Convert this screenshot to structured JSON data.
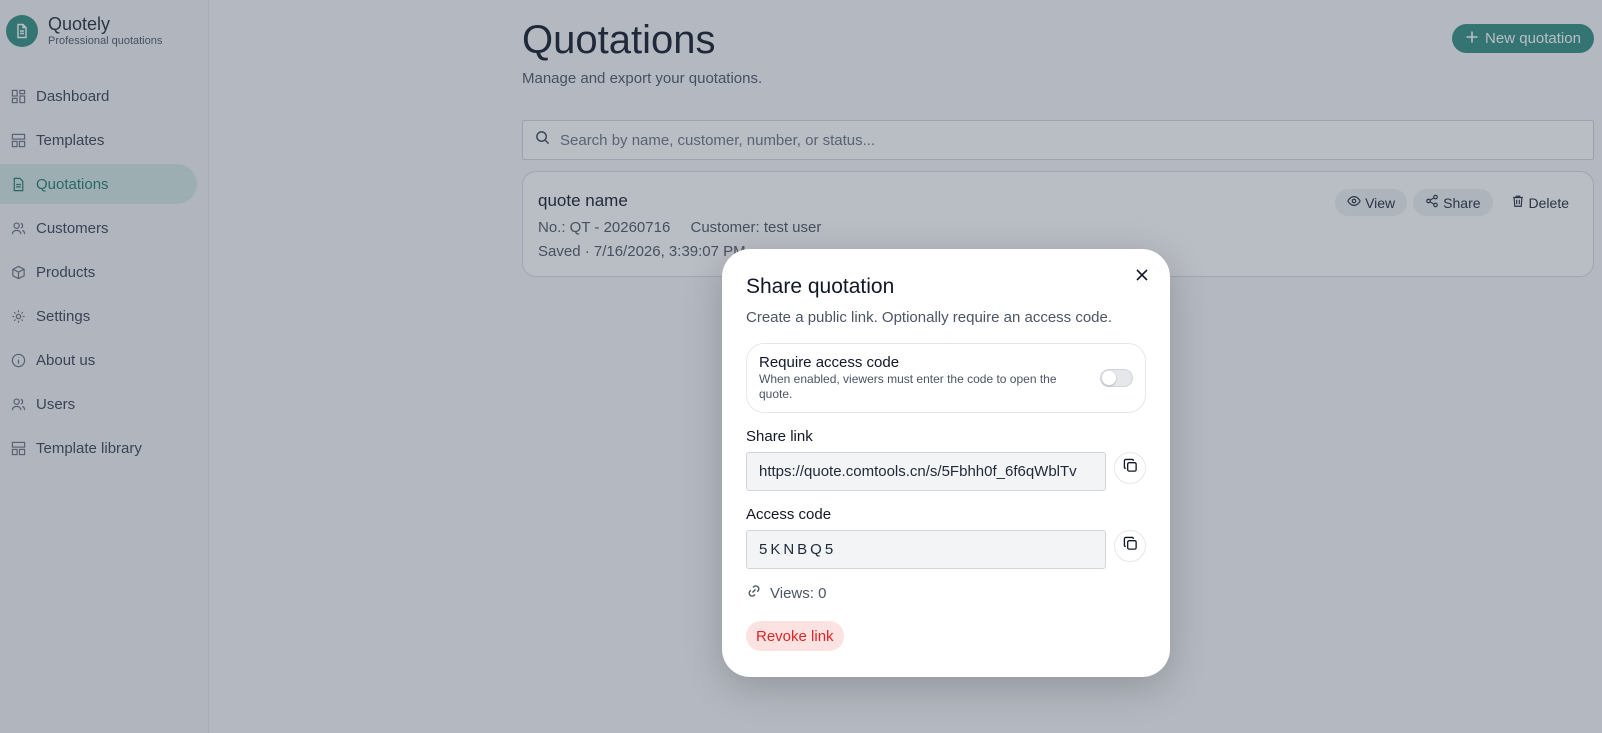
{
  "brand": {
    "name": "Quotely",
    "subtitle": "Professional quotations"
  },
  "sidebar": {
    "items": [
      {
        "label": "Dashboard",
        "icon": "dashboard-icon"
      },
      {
        "label": "Templates",
        "icon": "template-icon"
      },
      {
        "label": "Quotations",
        "icon": "document-icon",
        "active": true
      },
      {
        "label": "Customers",
        "icon": "users-icon"
      },
      {
        "label": "Products",
        "icon": "box-icon"
      },
      {
        "label": "Settings",
        "icon": "gear-icon"
      },
      {
        "label": "About us",
        "icon": "info-icon"
      },
      {
        "label": "Users",
        "icon": "users-icon"
      },
      {
        "label": "Template library",
        "icon": "template-icon"
      }
    ]
  },
  "page": {
    "title": "Quotations",
    "subtitle": "Manage and export your quotations.",
    "new_button": "New quotation",
    "search_placeholder": "Search by name, customer, number, or status..."
  },
  "quote": {
    "name": "quote name",
    "number": "No.: QT - 20260716",
    "customer": "Customer: test user",
    "saved": "Saved · 7/16/2026, 3:39:07 PM",
    "actions": {
      "view": "View",
      "share": "Share",
      "delete": "Delete"
    }
  },
  "modal": {
    "title": "Share quotation",
    "description": "Create a public link. Optionally require an access code.",
    "toggle_title": "Require access code",
    "toggle_hint": "When enabled, viewers must enter the code to open the quote.",
    "toggle_on": false,
    "share_link_label": "Share link",
    "share_link_value": "https://quote.comtools.cn/s/5Fbhh0f_6f6qWblTv",
    "access_code_label": "Access code",
    "access_code_value": "5KNBQ5",
    "views": "Views: 0",
    "revoke": "Revoke link"
  },
  "colors": {
    "accent": "#2f8f80",
    "danger": "#dc2626"
  }
}
